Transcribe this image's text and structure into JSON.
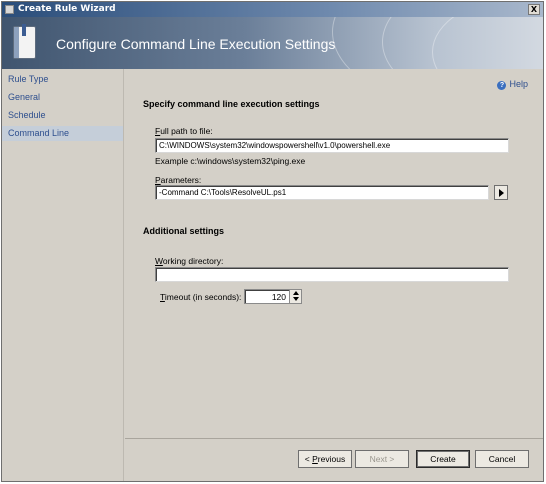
{
  "window": {
    "title": "Create Rule Wizard",
    "close_glyph": "X"
  },
  "banner": {
    "title": "Configure Command Line Execution Settings",
    "icon": "wizard-book-icon"
  },
  "sidebar": {
    "items": [
      {
        "label": "Rule Type"
      },
      {
        "label": "General"
      },
      {
        "label": "Schedule"
      },
      {
        "label": "Command Line",
        "selected": true
      }
    ]
  },
  "help": {
    "label": "Help",
    "icon_glyph": "?"
  },
  "command_section": {
    "title": "Specify command line execution settings",
    "path_label_key": "F",
    "path_label_rest": "ull path to file:",
    "path_value": "C:\\WINDOWS\\system32\\windowspowershell\\v1.0\\powershell.exe",
    "example": "Example c:\\windows\\system32\\ping.exe",
    "params_label_key": "P",
    "params_label_rest": "arameters:",
    "params_value": "-Command C:\\Tools\\ResolveUL.ps1"
  },
  "additional_section": {
    "title": "Additional settings",
    "workdir_label_key": "W",
    "workdir_label_rest": "orking directory:",
    "workdir_value": "",
    "timeout_label_key": "T",
    "timeout_label_rest": "imeout (in seconds):",
    "timeout_value": "120"
  },
  "footer": {
    "previous_prefix": "< ",
    "previous_key": "P",
    "previous_rest": "revious",
    "next_label": "Next >",
    "create_label": "Create",
    "cancel_label": "Cancel"
  }
}
